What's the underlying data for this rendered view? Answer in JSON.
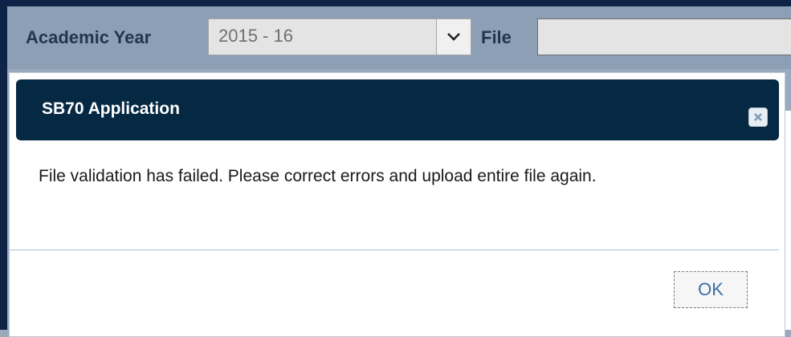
{
  "toolbar": {
    "academic_year_label": "Academic Year",
    "academic_year_value": "2015 - 16",
    "file_label": "File",
    "file_value": ""
  },
  "dialog": {
    "title": "SB70 Application",
    "message": "File validation has failed. Please correct errors and upload entire file again.",
    "ok_label": "OK"
  },
  "colors": {
    "frame": "#0e2447",
    "toolbar_bg": "#8d9fb4",
    "dialog_header": "#062943",
    "ok_text": "#3b6ea5"
  },
  "icons": {
    "dropdown": "chevron-down-icon",
    "close": "close-icon"
  }
}
